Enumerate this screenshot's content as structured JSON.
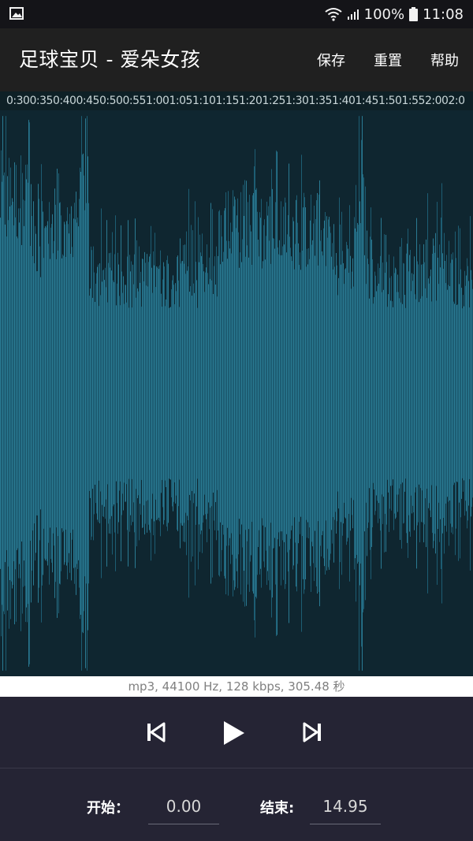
{
  "status_bar": {
    "battery": "100%",
    "time": "11:08"
  },
  "app_bar": {
    "title": "足球宝贝 - 爱朵女孩",
    "actions": {
      "save": "保存",
      "reset": "重置",
      "help": "帮助"
    }
  },
  "timeline": {
    "ticks": [
      "0:30",
      "0:35",
      "0:40",
      "0:45",
      "0:50",
      "0:55",
      "1:00",
      "1:05",
      "1:10",
      "1:15",
      "1:20",
      "1:25",
      "1:30",
      "1:35",
      "1:40",
      "1:45",
      "1:50",
      "1:55",
      "2:00",
      "2:0"
    ]
  },
  "waveform": {
    "colors": {
      "background": "#0f2630",
      "wave": "#1d5d73",
      "wave_light": "#2a7a92"
    }
  },
  "file_info": "mp3, 44100 Hz, 128 kbps, 305.48 秒",
  "transport": {
    "icons": [
      "skip-previous-icon",
      "play-icon",
      "skip-next-icon"
    ]
  },
  "range": {
    "start_label": "开始：",
    "start_value": "0.00",
    "end_label": "结束:",
    "end_value": "14.95"
  }
}
